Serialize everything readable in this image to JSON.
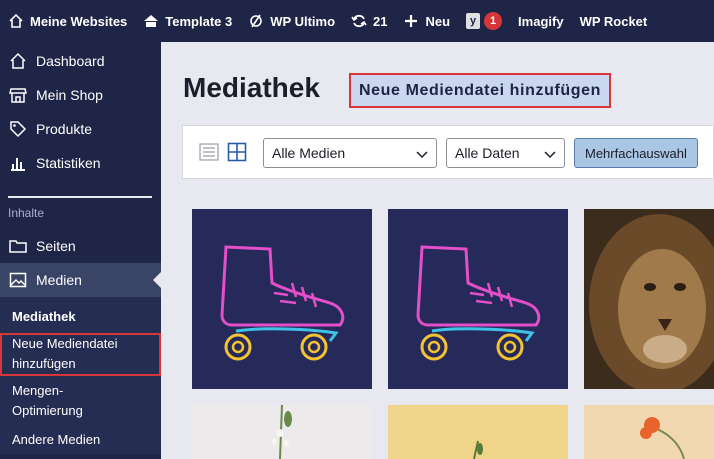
{
  "adminbar": {
    "sites": "Meine Websites",
    "template": "Template 3",
    "wpultimo": "WP Ultimo",
    "updates": "21",
    "new": "Neu",
    "yoast_count": "1",
    "imagify": "Imagify",
    "wprocket": "WP Rocket"
  },
  "sidebar": {
    "items": [
      {
        "label": "Dashboard"
      },
      {
        "label": "Mein Shop"
      },
      {
        "label": "Produkte"
      },
      {
        "label": "Statistiken"
      }
    ],
    "section": "Inhalte",
    "content_items": [
      {
        "label": "Seiten"
      },
      {
        "label": "Medien"
      }
    ],
    "submenu": [
      {
        "label": "Mediathek"
      },
      {
        "label": "Neue Mediendatei hinzufügen"
      },
      {
        "label": "Mengen-Optimierung"
      },
      {
        "label": "Andere Medien"
      }
    ]
  },
  "main": {
    "title": "Mediathek",
    "add_button": "Neue Mediendatei hinzufügen",
    "filter_media": "Alle Medien",
    "filter_dates": "Alle Daten",
    "bulk_select": "Mehrfachauswahl"
  },
  "colors": {
    "adminbar": "#1e2546",
    "highlight": "#d63638",
    "accent": "#a9c7e4"
  }
}
